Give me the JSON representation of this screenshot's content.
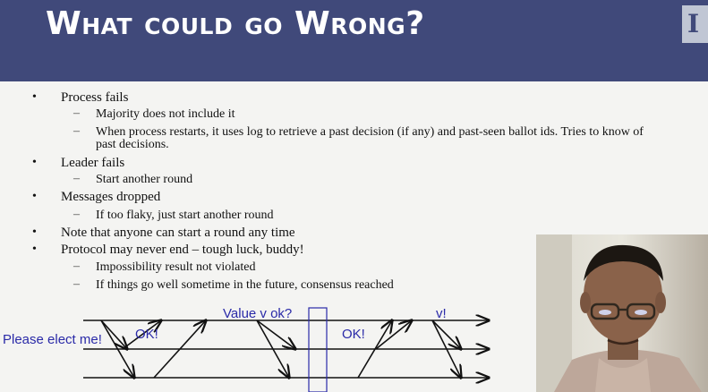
{
  "slide": {
    "title": "What could go Wrong?",
    "logo_letter": "I",
    "bullets": [
      {
        "text": "Process fails"
      },
      {
        "text": "Majority does not include it"
      },
      {
        "text": "When process restarts, it uses log to retrieve a past decision (if any) and past-seen ballot ids. Tries to know of"
      },
      {
        "text": "past decisions."
      },
      {
        "text": "Leader fails"
      },
      {
        "text": "Start another round"
      },
      {
        "text": "Messages dropped"
      },
      {
        "text": "If too flaky, just start another round"
      },
      {
        "text": "Note that anyone can start a round any time"
      },
      {
        "text": "Protocol may never end – tough luck, buddy!"
      },
      {
        "text": "Impossibility result not violated"
      },
      {
        "text": "If things go well sometime in the future, consensus reached"
      }
    ]
  },
  "diagram": {
    "labels": {
      "please_elect": "Please elect me!",
      "ok1": "OK!",
      "value_ok": "Value v ok?",
      "ok2": "OK!",
      "v": "v!"
    }
  },
  "colors": {
    "title_bar": "#40497a",
    "diagram_text": "#2a2aa8"
  }
}
